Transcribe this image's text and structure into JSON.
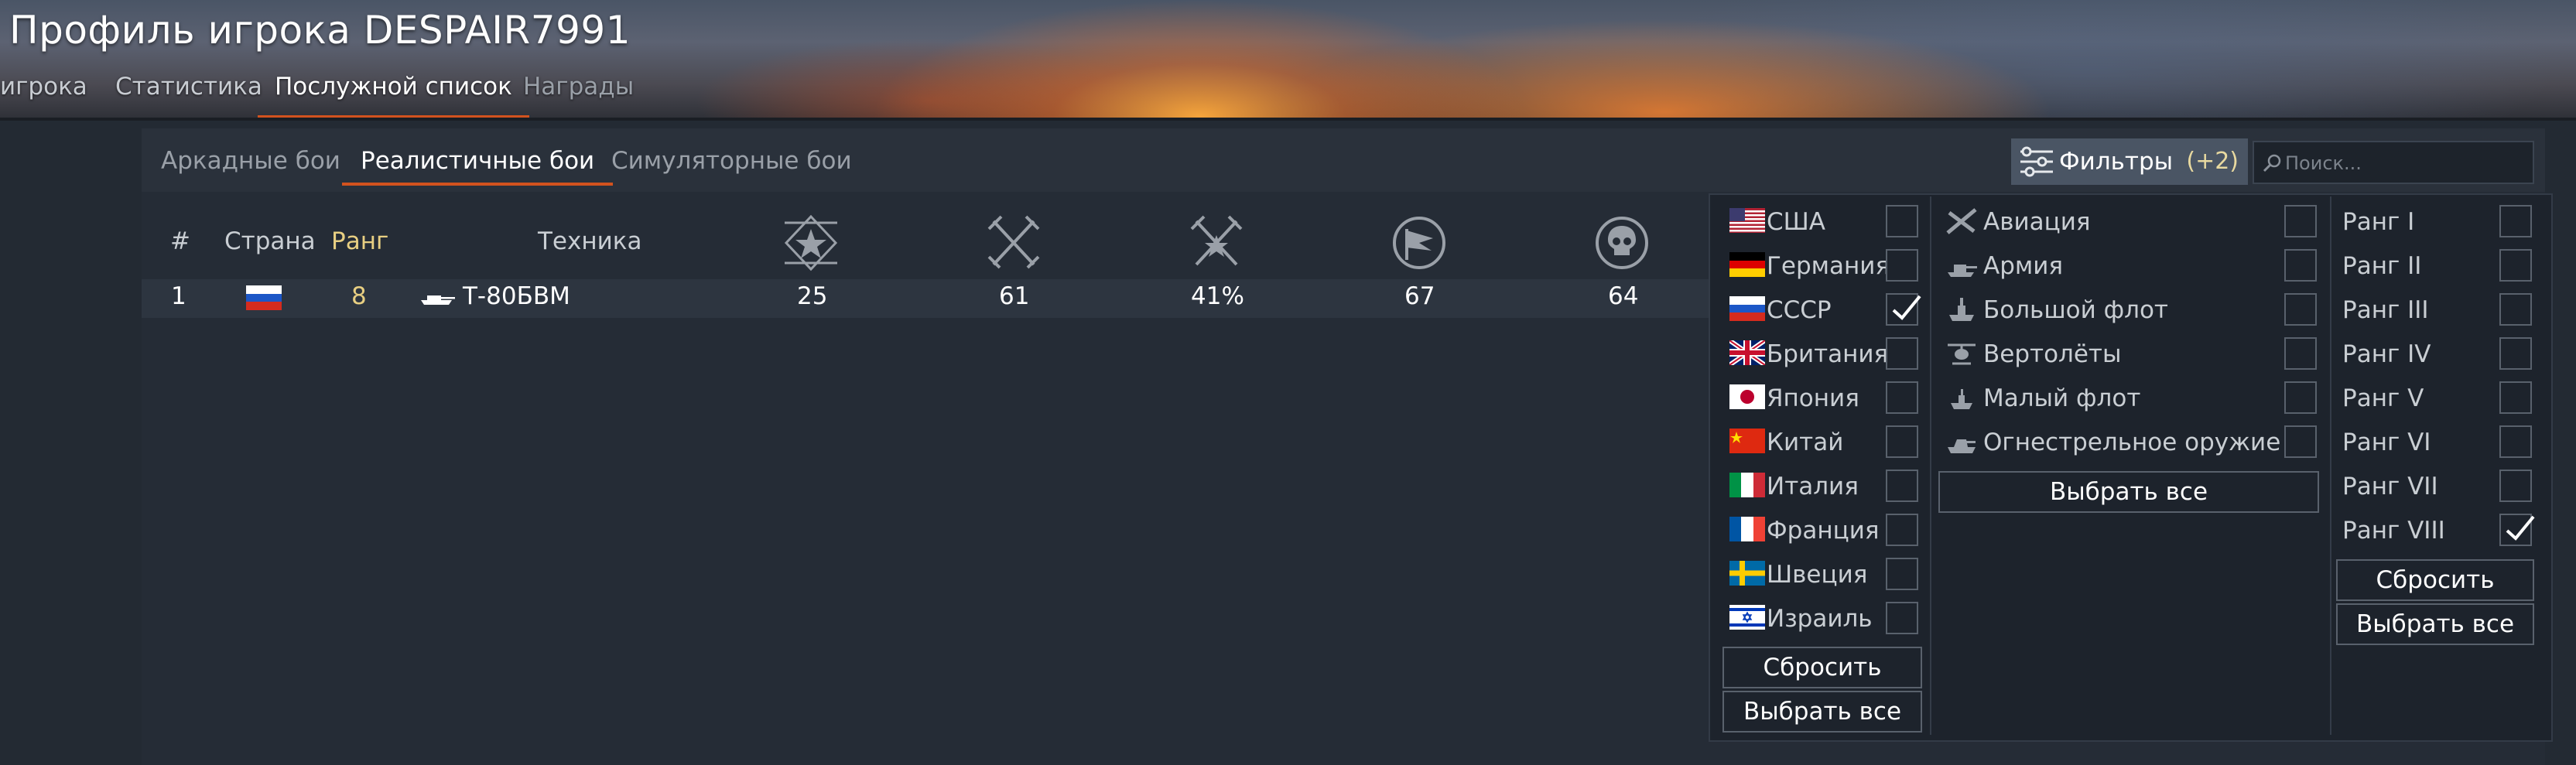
{
  "header": {
    "title": "Профиль игрока DESPAIR7991",
    "tabs": [
      "игрока",
      "Статистика",
      "Послужной список",
      "Награды"
    ]
  },
  "modes": [
    "Аркадные бои",
    "Реалистичные бои",
    "Симуляторные бои"
  ],
  "filters": {
    "label": "Фильтры",
    "count": "(+2)",
    "search_placeholder": "Поиск..."
  },
  "table": {
    "headers": {
      "num": "#",
      "country": "Страна",
      "rank": "Ранг",
      "vehicle": "Техника"
    },
    "stat_icons": [
      "ground-kills-icon",
      "air-kills-icon",
      "kills-percent-icon",
      "captures-icon",
      "deaths-icon"
    ],
    "rows": [
      {
        "num": "1",
        "rank": "8",
        "vehicle": "Т-80БВМ",
        "s1": "25",
        "s2": "61",
        "s3": "41%",
        "s4": "67",
        "s5": "64"
      }
    ]
  },
  "countries": [
    {
      "label": "США",
      "checked": false
    },
    {
      "label": "Германия",
      "checked": false
    },
    {
      "label": "СССР",
      "checked": true
    },
    {
      "label": "Британия",
      "checked": false
    },
    {
      "label": "Япония",
      "checked": false
    },
    {
      "label": "Китай",
      "checked": false
    },
    {
      "label": "Италия",
      "checked": false
    },
    {
      "label": "Франция",
      "checked": false
    },
    {
      "label": "Швеция",
      "checked": false
    },
    {
      "label": "Израиль",
      "checked": false
    }
  ],
  "classes": [
    {
      "label": "Авиация",
      "checked": false
    },
    {
      "label": "Армия",
      "checked": false
    },
    {
      "label": "Большой флот",
      "checked": false
    },
    {
      "label": "Вертолёты",
      "checked": false
    },
    {
      "label": "Малый флот",
      "checked": false
    },
    {
      "label": "Огнестрельное оружие",
      "checked": false
    }
  ],
  "ranks": [
    {
      "label": "Ранг I",
      "checked": false
    },
    {
      "label": "Ранг II",
      "checked": false
    },
    {
      "label": "Ранг III",
      "checked": false
    },
    {
      "label": "Ранг IV",
      "checked": false
    },
    {
      "label": "Ранг V",
      "checked": false
    },
    {
      "label": "Ранг VI",
      "checked": false
    },
    {
      "label": "Ранг VII",
      "checked": false
    },
    {
      "label": "Ранг VIII",
      "checked": true
    }
  ],
  "buttons": {
    "reset": "Сбросить",
    "select_all": "Выбрать все"
  },
  "colors": {
    "accent": "#d2521e",
    "rank": "#e8cf82",
    "badge": "#e8d9a0"
  }
}
